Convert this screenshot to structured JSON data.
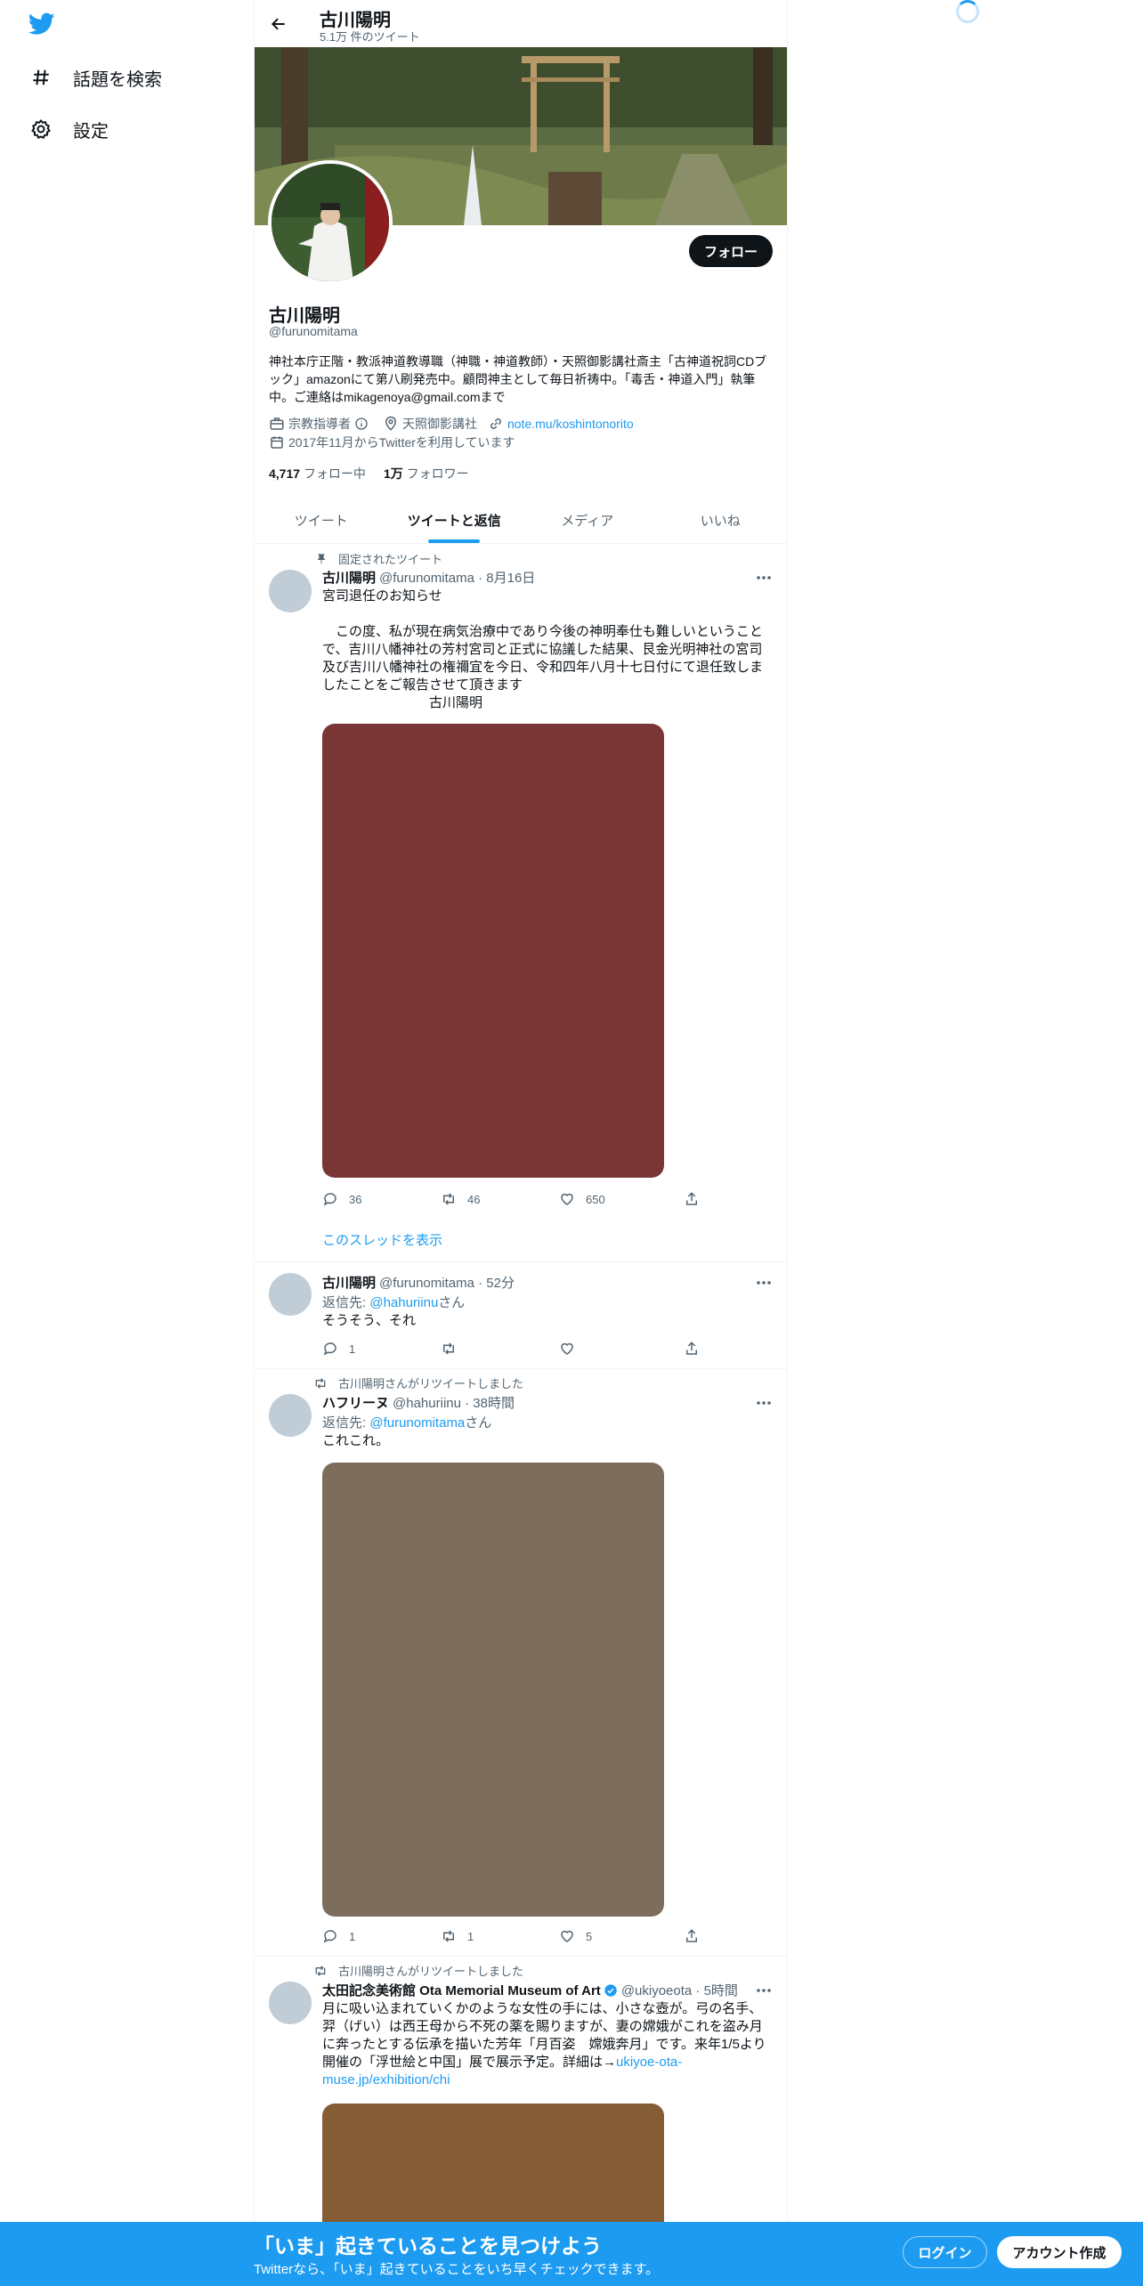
{
  "nav": {
    "items": [
      {
        "label": "話題を検索",
        "icon": "hashtag-icon"
      },
      {
        "label": "設定",
        "icon": "gear-icon"
      }
    ]
  },
  "header": {
    "title": "古川陽明",
    "subtitle": "5.1万 件のツイート"
  },
  "profile": {
    "name": "古川陽明",
    "handle": "@furunomitama",
    "follow_label": "フォロー",
    "bio": "神社本庁正階・教派神道教導職（神職・神道教師）・天照御影講社斎主「古神道祝詞CDブック」amazonにて第八刷発売中。顧問神主として毎日祈祷中。「毒舌・神道入門」執筆中。ご連絡はmikagenoya@gmail.comまで",
    "category": "宗教指導者",
    "location": "天照御影講社",
    "url": "note.mu/koshintonorito",
    "joined": "2017年11月からTwitterを利用しています",
    "following_count": "4,717",
    "following_label": "フォロー中",
    "followers_count": "1万",
    "followers_label": "フォロワー"
  },
  "tabs": [
    "ツイート",
    "ツイートと返信",
    "メディア",
    "いいね"
  ],
  "tweets": [
    {
      "context": "固定されたツイート",
      "name": "古川陽明",
      "handle_time": "@furunomitama · 8月16日",
      "text": "宮司退任のお知らせ\n\n　この度、私が現在病気治療中であり今後の神明奉仕も難しいということで、吉川八幡神社の芳村宮司と正式に協議した結果、艮金光明神社の宮司及び吉川八幡神社の権禰宜を今日、令和四年八月十七日付にて退任致しましたことをご報告させて頂きます\n　　　　　　　　古川陽明",
      "media_color": "#7a3535",
      "replies": "36",
      "retweets": "46",
      "likes": "650",
      "thread_link": "このスレッドを表示"
    },
    {
      "name": "古川陽明",
      "handle_time": "@furunomitama · 52分",
      "reply_prefix": "返信先: ",
      "reply_to": "@hahuriinu",
      "reply_suffix": "さん",
      "text": "そうそう、それ",
      "replies": "1",
      "retweets": "",
      "likes": ""
    },
    {
      "context": "古川陽明さんがリツイートしました",
      "name": "ハフリーヌ",
      "handle_time": "@hahuriinu · 38時間",
      "reply_prefix": "返信先: ",
      "reply_to": "@furunomitama",
      "reply_suffix": "さん",
      "text": "これこれ。",
      "media_color": "#7d6d5d",
      "replies": "1",
      "retweets": "1",
      "likes": "5"
    },
    {
      "context": "古川陽明さんがリツイートしました",
      "name": "太田記念美術館 Ota Memorial Museum of Art",
      "handle_time": "@ukiyoeota · 5時間",
      "text_main": "月に吸い込まれていくかのような女性の手には、小さな壺が。弓の名手、羿（げい）は西王母から不死の薬を賜りますが、妻の嫦娥がこれを盗み月に奔ったとする伝承を描いた芳年「月百姿　嫦娥奔月」です。来年1/5より開催の「浮世絵と中国」展で展示予定。詳細は→",
      "text_link": "ukiyoe-ota-muse.jp/exhibition/chi",
      "media_color": "#845c35"
    }
  ],
  "bottom_bar": {
    "title": "「いま」起きていることを見つけよう",
    "subtitle": "Twitterなら、「いま」起きていることをいち早くチェックできます。",
    "login_label": "ログイン",
    "signup_label": "アカウント作成"
  },
  "colors": {
    "accent": "#1d9bf0",
    "text": "#0f1419",
    "secondary": "#536471"
  }
}
